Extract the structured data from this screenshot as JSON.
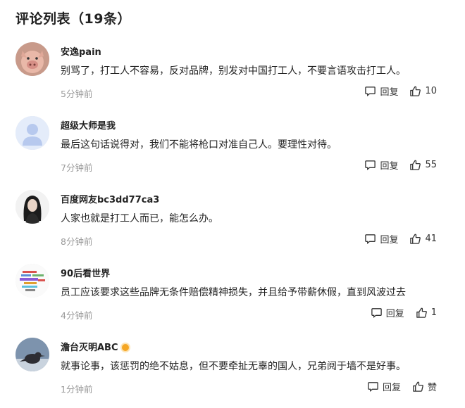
{
  "header": {
    "title": "评论列表（19条）"
  },
  "comments": [
    {
      "username": "安逸pain",
      "text": "别骂了，打工人不容易，反对品牌，别发对中国打工人，不要言语攻击打工人。",
      "time": "5分钟前",
      "reply_label": "回复",
      "likes": "10",
      "avatar": "pig-avatar-icon"
    },
    {
      "username": "超级大师是我",
      "text": "最后这句话说得对，我们不能将枪口对准自己人。要理性对待。",
      "time": "7分钟前",
      "reply_label": "回复",
      "likes": "55",
      "avatar": "default-user-avatar-icon"
    },
    {
      "username": "百度网友bc3dd77ca3",
      "text": "人家也就是打工人而已，能怎么办。",
      "time": "8分钟前",
      "reply_label": "回复",
      "likes": "41",
      "avatar": "woman-portrait-avatar-icon"
    },
    {
      "username": "90后看世界",
      "text": "员工应该要求这些品牌无条件赔偿精神损失，并且给予带薪休假，直到风波过去",
      "time": "4分钟前",
      "reply_label": "回复",
      "likes": "1",
      "avatar": "word-cloud-avatar-icon"
    },
    {
      "username": "澹台灭明ABC",
      "text": "就事论事，该惩罚的绝不姑息，但不要牵扯无辜的国人，兄弟阋于墙不是好事。",
      "time": "1分钟前",
      "reply_label": "回复",
      "likes": "赞",
      "avatar": "bird-avatar-icon",
      "badge": "verified-badge-icon"
    }
  ],
  "colors": {
    "time": "#999999",
    "text": "#222222",
    "badge": "#f5a623"
  }
}
